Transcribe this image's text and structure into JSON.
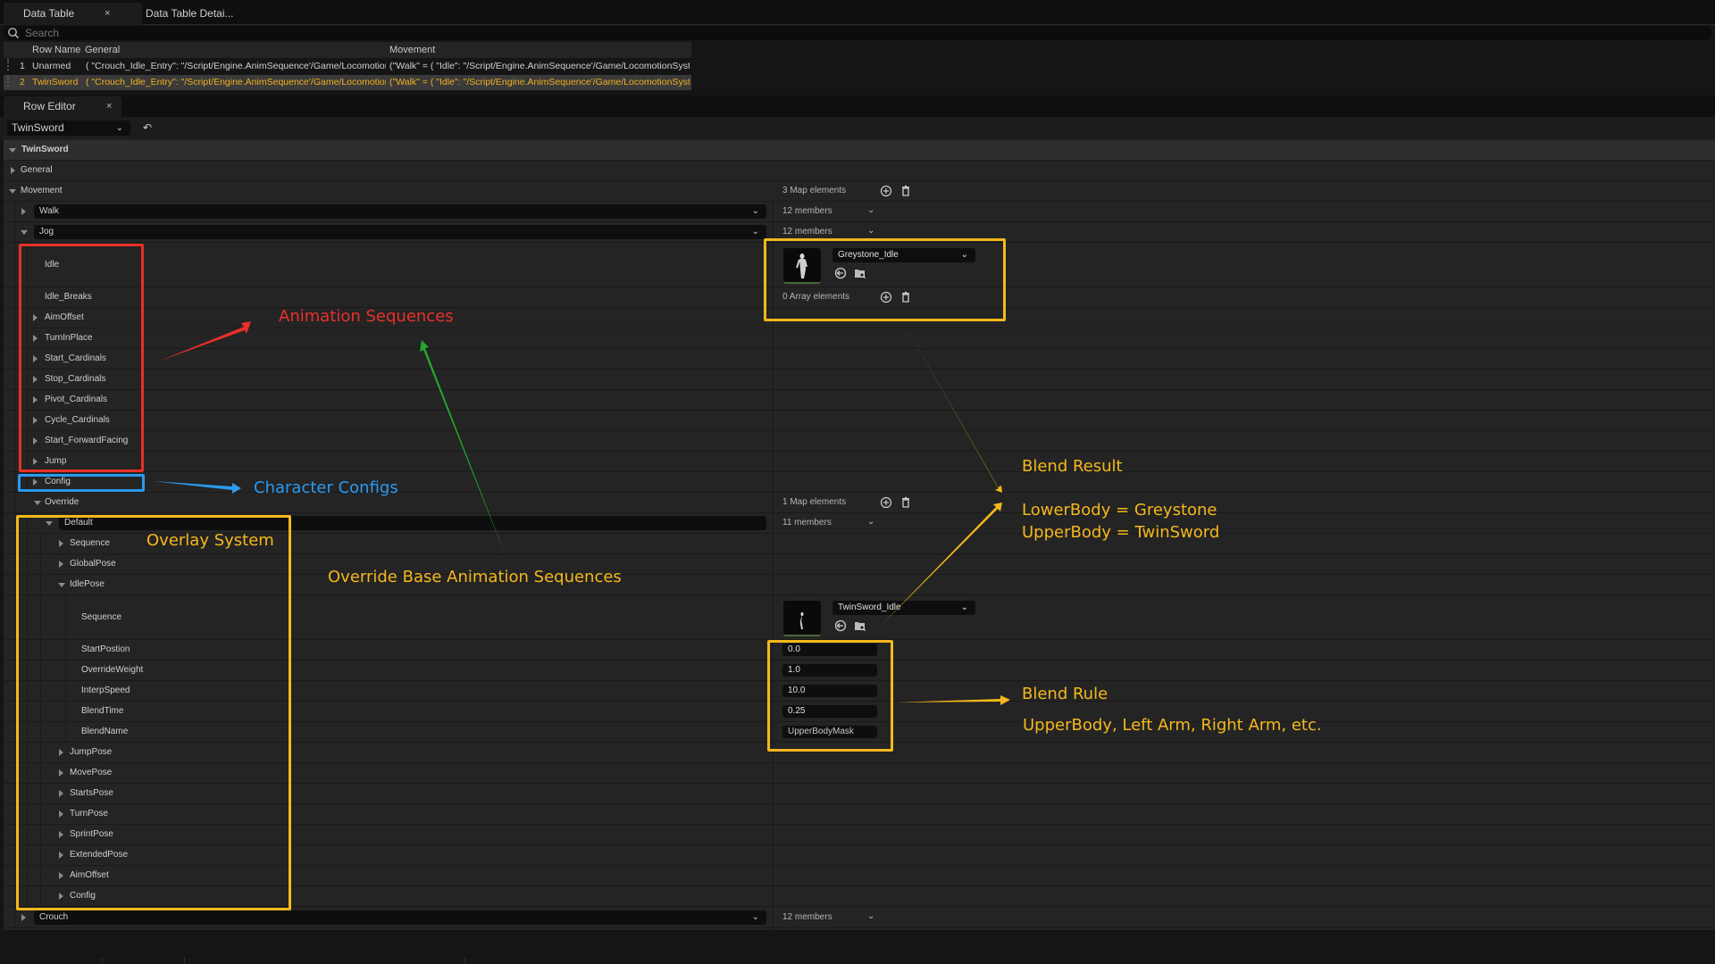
{
  "tabs": [
    {
      "label": "Data Table",
      "close": "×",
      "active": true
    },
    {
      "label": "Data Table Detai...",
      "active": false
    }
  ],
  "search": {
    "placeholder": "Search",
    "icon": "search-icon"
  },
  "data_table": {
    "columns": [
      "Row Name",
      "General",
      "Movement"
    ],
    "rows": [
      {
        "index": "1",
        "name": "Unarmed",
        "general": "( \"Crouch_Idle_Entry\": \"/Script/Engine.AnimSequence'/Game/LocomotionS",
        "movement": "(\"Walk\" = ( \"Idle\": \"/Script/Engine.AnimSequence'/Game/LocomotionSyste",
        "selected": false
      },
      {
        "index": "2",
        "name": "TwinSword",
        "general": "( \"Crouch_Idle_Entry\": \"/Script/Engine.AnimSequence'/Game/LocomotionS",
        "movement": "(\"Walk\" = ( \"Idle\": \"/Script/Engine.AnimSequence'/Game/LocomotionSyste",
        "selected": true
      }
    ]
  },
  "row_editor": {
    "tab_label": "Row Editor",
    "close": "×",
    "selected_row": "TwinSword",
    "undo_icon": "reset-arrow-icon"
  },
  "tree": {
    "root": "TwinSword",
    "general": "General",
    "movement": {
      "label": "Movement",
      "value": "3 Map elements"
    },
    "walk": {
      "label": "Walk",
      "value": "12 members"
    },
    "jog": {
      "label": "Jog",
      "value": "12 members"
    },
    "idle": {
      "label": "Idle",
      "asset": "Greystone_Idle"
    },
    "idle_breaks": {
      "label": "Idle_Breaks",
      "value": "0 Array elements"
    },
    "jog_children": [
      "AimOffset",
      "TurnInPlace",
      "Start_Cardinals",
      "Stop_Cardinals",
      "Pivot_Cardinals",
      "Cycle_Cardinals",
      "Start_ForwardFacing",
      "Jump",
      "Config"
    ],
    "override": {
      "label": "Override",
      "value": "1 Map elements"
    },
    "default": {
      "label": "Default",
      "value": "11 members"
    },
    "default_children_top": [
      "Sequence",
      "GlobalPose"
    ],
    "idle_pose": {
      "label": "IdlePose",
      "sequence": {
        "label": "Sequence",
        "asset": "TwinSword_Idle"
      },
      "fields": [
        {
          "label": "StartPostion",
          "value": "0.0"
        },
        {
          "label": "OverrideWeight",
          "value": "1.0"
        },
        {
          "label": "InterpSpeed",
          "value": "10.0"
        },
        {
          "label": "BlendTime",
          "value": "0.25"
        },
        {
          "label": "BlendName",
          "value": "UpperBodyMask"
        }
      ]
    },
    "default_children_bottom": [
      "JumpPose",
      "MovePose",
      "StartsPose",
      "TurnPose",
      "SprintPose",
      "ExtendedPose",
      "AimOffset",
      "Config"
    ],
    "crouch": {
      "label": "Crouch",
      "value": "12 members"
    }
  },
  "annotations": {
    "animation_sequences": {
      "text": "Animation Sequences",
      "color": "#e8302a"
    },
    "character_configs": {
      "text": "Character Configs",
      "color": "#2b9af0"
    },
    "overlay_system": {
      "text": "Overlay System",
      "color": "#f5b81c"
    },
    "override_base": {
      "text": "Override Base Animation Sequences",
      "color": "#f5b81c"
    },
    "blend_result_title": {
      "text": "Blend Result",
      "color": "#f5b81c"
    },
    "blend_result_line1": "LowerBody = Greystone",
    "blend_result_line2": "UpperBody = TwinSword",
    "blend_rule_title": {
      "text": "Blend Rule",
      "color": "#f5b81c"
    },
    "blend_rule_detail": "UpperBody, Left Arm, Right Arm, etc.",
    "green_arrow_color": "#22a82a"
  },
  "colors": {
    "accent_selected_text": "#f0b020",
    "panel_bg": "#242424",
    "input_bg": "#0e0e0e"
  }
}
